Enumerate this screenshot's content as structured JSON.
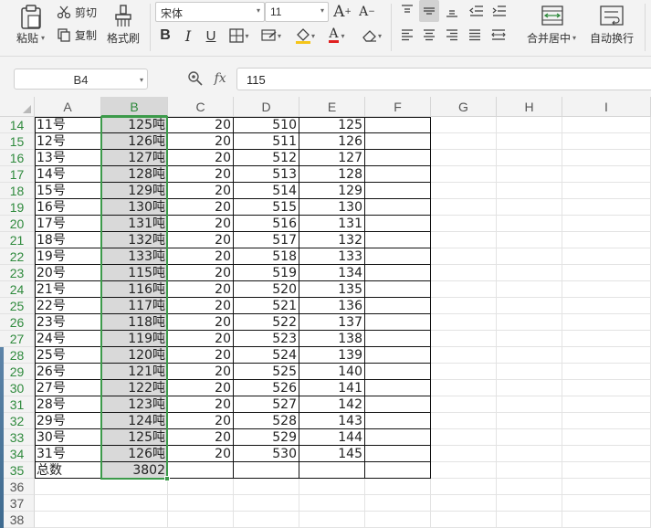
{
  "ribbon": {
    "paste_label": "粘贴",
    "cut_label": "剪切",
    "copy_label": "复制",
    "format_painter_label": "格式刷",
    "font_name": "宋体",
    "font_size": "11",
    "merge_center_label": "合并居中",
    "wrap_text_label": "自动换行",
    "font_color": "#e02020",
    "fill_color": "#f5c518"
  },
  "formula_bar": {
    "name_box": "B4",
    "fx_label": "fx",
    "formula_value": "115"
  },
  "grid": {
    "columns": [
      "A",
      "B",
      "C",
      "D",
      "E",
      "F",
      "G",
      "H",
      "I"
    ],
    "selected_column": "B",
    "rows": [
      {
        "row": "14",
        "a": "11号",
        "b": "125吨",
        "c": "20",
        "d": "510",
        "e": "125"
      },
      {
        "row": "15",
        "a": "12号",
        "b": "126吨",
        "c": "20",
        "d": "511",
        "e": "126"
      },
      {
        "row": "16",
        "a": "13号",
        "b": "127吨",
        "c": "20",
        "d": "512",
        "e": "127"
      },
      {
        "row": "17",
        "a": "14号",
        "b": "128吨",
        "c": "20",
        "d": "513",
        "e": "128"
      },
      {
        "row": "18",
        "a": "15号",
        "b": "129吨",
        "c": "20",
        "d": "514",
        "e": "129"
      },
      {
        "row": "19",
        "a": "16号",
        "b": "130吨",
        "c": "20",
        "d": "515",
        "e": "130"
      },
      {
        "row": "20",
        "a": "17号",
        "b": "131吨",
        "c": "20",
        "d": "516",
        "e": "131"
      },
      {
        "row": "21",
        "a": "18号",
        "b": "132吨",
        "c": "20",
        "d": "517",
        "e": "132"
      },
      {
        "row": "22",
        "a": "19号",
        "b": "133吨",
        "c": "20",
        "d": "518",
        "e": "133"
      },
      {
        "row": "23",
        "a": "20号",
        "b": "115吨",
        "c": "20",
        "d": "519",
        "e": "134"
      },
      {
        "row": "24",
        "a": "21号",
        "b": "116吨",
        "c": "20",
        "d": "520",
        "e": "135"
      },
      {
        "row": "25",
        "a": "22号",
        "b": "117吨",
        "c": "20",
        "d": "521",
        "e": "136"
      },
      {
        "row": "26",
        "a": "23号",
        "b": "118吨",
        "c": "20",
        "d": "522",
        "e": "137"
      },
      {
        "row": "27",
        "a": "24号",
        "b": "119吨",
        "c": "20",
        "d": "523",
        "e": "138"
      },
      {
        "row": "28",
        "a": "25号",
        "b": "120吨",
        "c": "20",
        "d": "524",
        "e": "139"
      },
      {
        "row": "29",
        "a": "26号",
        "b": "121吨",
        "c": "20",
        "d": "525",
        "e": "140"
      },
      {
        "row": "30",
        "a": "27号",
        "b": "122吨",
        "c": "20",
        "d": "526",
        "e": "141"
      },
      {
        "row": "31",
        "a": "28号",
        "b": "123吨",
        "c": "20",
        "d": "527",
        "e": "142"
      },
      {
        "row": "32",
        "a": "29号",
        "b": "124吨",
        "c": "20",
        "d": "528",
        "e": "143"
      },
      {
        "row": "33",
        "a": "30号",
        "b": "125吨",
        "c": "20",
        "d": "529",
        "e": "144"
      },
      {
        "row": "34",
        "a": "31号",
        "b": "126吨",
        "c": "20",
        "d": "530",
        "e": "145"
      },
      {
        "row": "35",
        "a": "总数",
        "b": "3802",
        "c": "",
        "d": "",
        "e": ""
      },
      {
        "row": "36",
        "a": "",
        "b": "",
        "c": "",
        "d": "",
        "e": ""
      },
      {
        "row": "37",
        "a": "",
        "b": "",
        "c": "",
        "d": "",
        "e": ""
      },
      {
        "row": "38",
        "a": "",
        "b": "",
        "c": "",
        "d": "",
        "e": ""
      }
    ]
  }
}
